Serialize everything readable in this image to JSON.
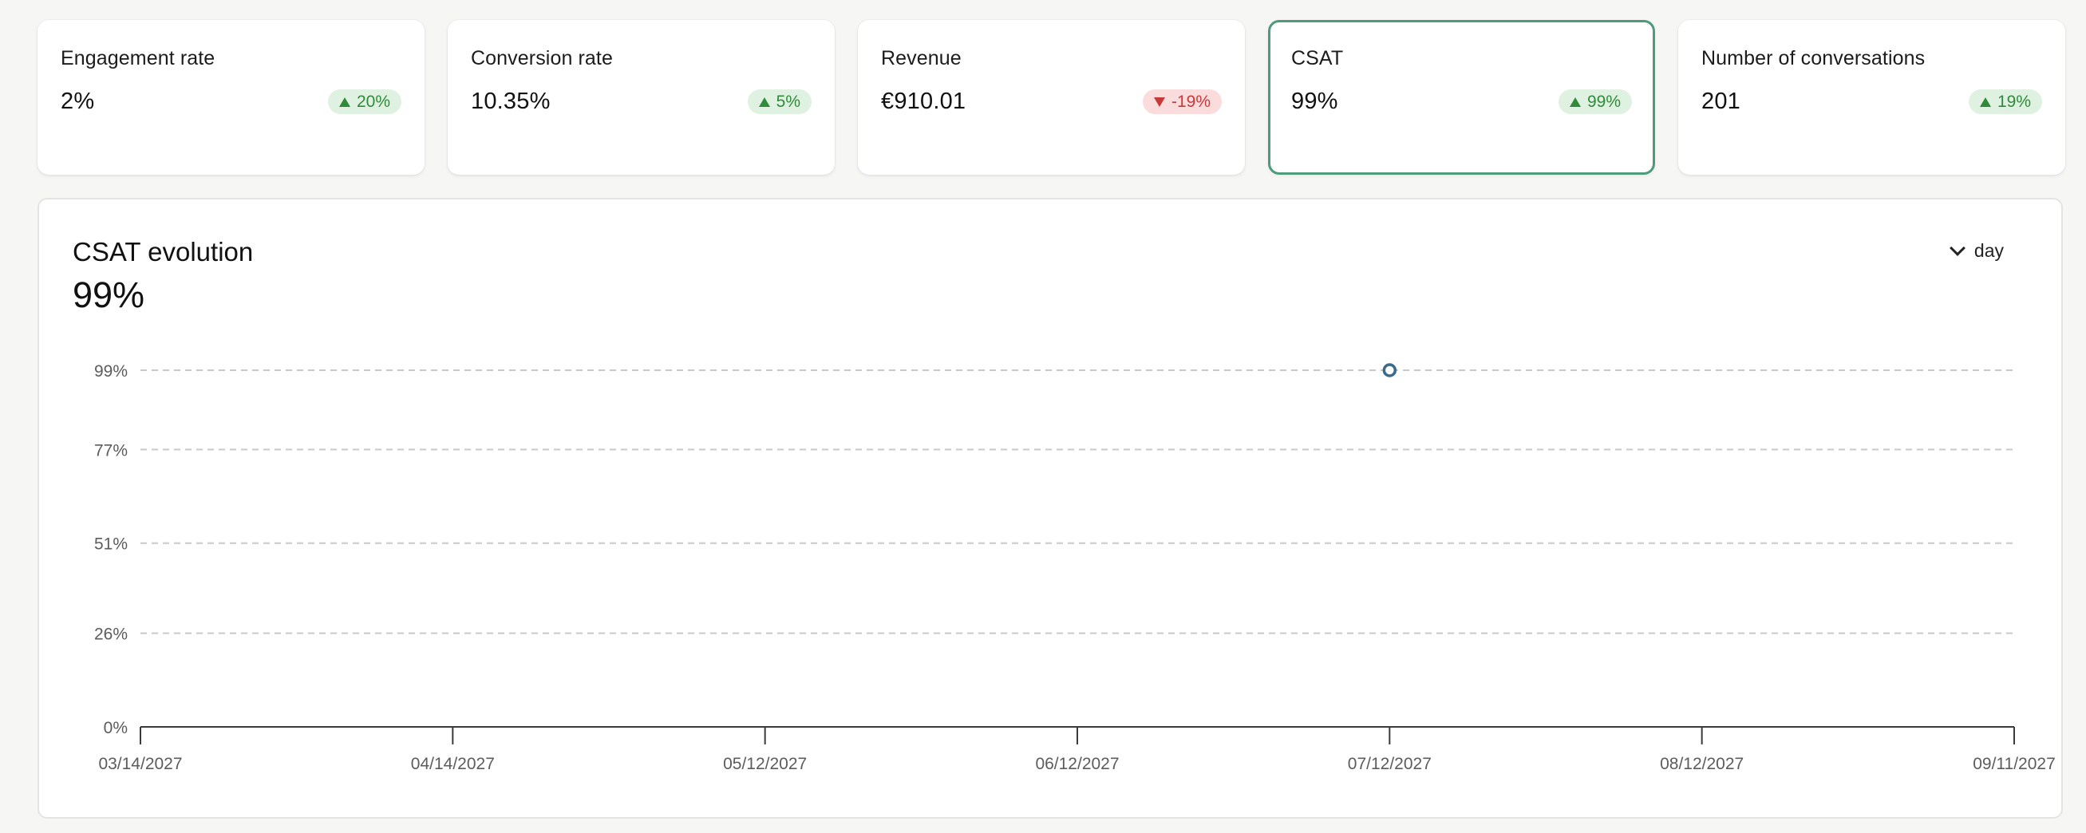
{
  "kpis": [
    {
      "title": "Engagement rate",
      "value": "2%",
      "change": "20%",
      "direction": "up",
      "selected": false
    },
    {
      "title": "Conversion rate",
      "value": "10.35%",
      "change": "5%",
      "direction": "up",
      "selected": false
    },
    {
      "title": "Revenue",
      "value": "€910.01",
      "change": "-19%",
      "direction": "down",
      "selected": false
    },
    {
      "title": "CSAT",
      "value": "99%",
      "change": "99%",
      "direction": "up",
      "selected": true
    },
    {
      "title": "Number of conversations",
      "value": "201",
      "change": "19%",
      "direction": "up",
      "selected": false
    }
  ],
  "chart_panel": {
    "title": "CSAT evolution",
    "value": "99%",
    "period": "day"
  },
  "colors": {
    "accent": "#4e9a7d",
    "up": "#2f8a3a",
    "up_bg": "#dff2e1",
    "down": "#c73a3a",
    "down_bg": "#fbdcdc",
    "point": "#3b6a8f"
  },
  "chart_data": {
    "type": "line",
    "y_ticks": [
      {
        "value": 0,
        "label": "0%"
      },
      {
        "value": 26,
        "label": "26%"
      },
      {
        "value": 51,
        "label": "51%"
      },
      {
        "value": 77,
        "label": "77%"
      },
      {
        "value": 99,
        "label": "99%"
      }
    ],
    "x_ticks": [
      "03/14/2027",
      "04/14/2027",
      "05/12/2027",
      "06/12/2027",
      "07/12/2027",
      "08/12/2027",
      "09/11/2027"
    ],
    "ylim": [
      0,
      99
    ],
    "grid": true,
    "series": [
      {
        "x": [
          "07/12/2027"
        ],
        "values": [
          99
        ]
      }
    ]
  }
}
